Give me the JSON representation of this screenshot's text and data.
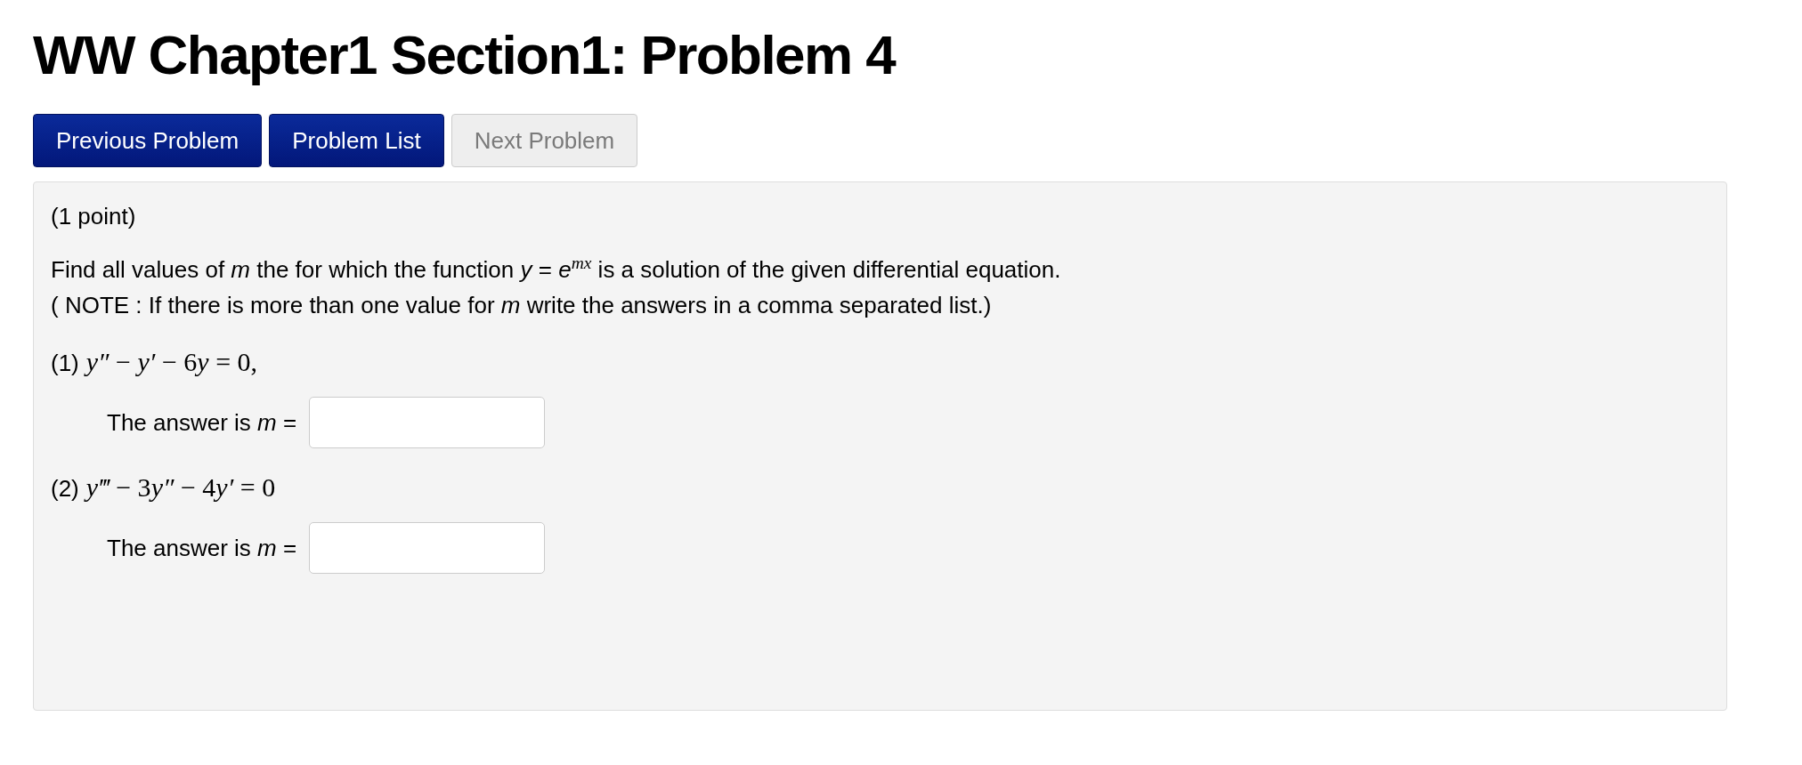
{
  "title": "WW Chapter1 Section1: Problem 4",
  "nav_buttons": [
    {
      "label": "Previous Problem",
      "disabled": false
    },
    {
      "label": "Problem List",
      "disabled": false
    },
    {
      "label": "Next Problem",
      "disabled": true
    }
  ],
  "problem": {
    "points": "(1 point)",
    "statement": [
      "Find all values of *m* the for which the function *y* = *e*$^{mx}$ is a solution of the given differential equation.",
      "( NOTE : If there is more than one value for *m* write the answers in a comma separated list.)"
    ],
    "parts": [
      {
        "label": "(1)",
        "equation": [
          {
            "kind": "var",
            "text": "y″"
          },
          {
            "kind": "op",
            "text": " − "
          },
          {
            "kind": "var",
            "text": "y′"
          },
          {
            "kind": "op",
            "text": " − 6"
          },
          {
            "kind": "var",
            "text": "y"
          },
          {
            "kind": "op",
            "text": " = 0,"
          }
        ],
        "answer_label": "The answer is *m* ="
      },
      {
        "label": "(2)",
        "equation": [
          {
            "kind": "var",
            "text": "y‴"
          },
          {
            "kind": "op",
            "text": " − 3"
          },
          {
            "kind": "var",
            "text": "y″"
          },
          {
            "kind": "op",
            "text": " − 4"
          },
          {
            "kind": "var",
            "text": "y′"
          },
          {
            "kind": "op",
            "text": " = 0"
          }
        ],
        "answer_label": "The answer is *m* ="
      }
    ]
  }
}
